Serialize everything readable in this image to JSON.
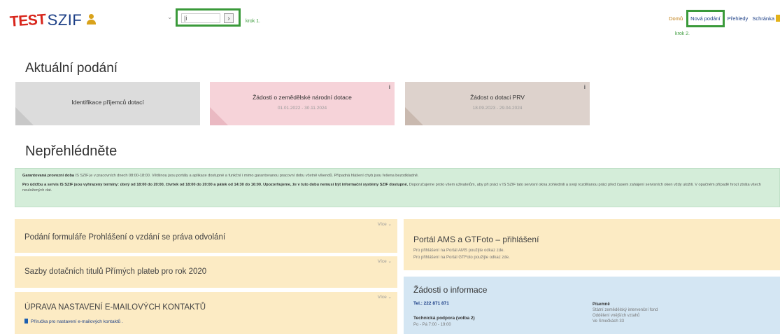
{
  "header": {
    "logo_test": "TEST",
    "logo_szif": "SZIF",
    "search_value": "|i",
    "search_button": "›",
    "krok1": "krok 1.",
    "nav": {
      "domu": "Domů",
      "nova_podani": "Nová podání",
      "prehledy": "Přehledy",
      "schranka": "Schránka"
    },
    "krok2": "krok 2."
  },
  "aktualni": {
    "heading": "Aktuální podání",
    "tiles": [
      {
        "title": "Identifikace příjemců dotací",
        "date": "",
        "info": ""
      },
      {
        "title": "Žádosti o zemědělské národní dotace",
        "date": "01.01.2022 - 30.11.2024",
        "info": "i"
      },
      {
        "title": "Žádost o dotaci PRV",
        "date": "18.09.2023 - 29.04.2024",
        "info": "i"
      }
    ]
  },
  "neprehlednete": {
    "heading": "Nepřehlédněte",
    "notice": {
      "p1_bold": "Garantovaná provozní doba",
      "p1_text": " IS SZIF je v pracovních dnech 08:00-18:00. Většinou jsou portály a aplikace dostupné a funkční i mimo garantovanou pracovní dobu včetně víkendů. Případná hlášení chyb jsou řešena bezodkladně.",
      "p2_bold": "Pro údržbu a servis IS SZIF jsou vyhrazeny termíny: úterý od 18:00 do 20:00, čtvrtek od 18:00 do 20:00 a pátek od 14:30 do 16:00. Upozorňujeme, že v tuto dobu nemusí být informační systémy SZIF dostupné.",
      "p2_text": " Doporučujeme proto všem uživatelům, aby při práci v IS SZIF tato servisní okna zohlednili a svoji rozdělanou práci před časem zahájení servisních oken vždy uložili. V opačném případě hrozí ztráta všech neuložených dat."
    },
    "vice": "Více ⌄",
    "cards": [
      {
        "title": "Podání formuláře Prohlášení o vzdání se práva odvolání"
      },
      {
        "title": "Sazby dotačních titulů Přímých plateb pro rok 2020"
      },
      {
        "title": "ÚPRAVA NASTAVENÍ E-MAILOVÝCH KONTAKTŮ",
        "link": "Příručka pro nastavení e-mailových kontaktů ."
      }
    ],
    "ams": {
      "title": "Portál AMS a GTFoto – přihlášení",
      "line1": "Pro přihlášení na Portál AMS použijte odkaz zde.",
      "line2": "Pro přihlášení na Portál GTFoto použijte odkaz zde."
    },
    "info": {
      "title": "Žádosti o informace",
      "tel": "Tel.: 222 871 871",
      "tech": "Technická podpora (volba 2)",
      "hours": "Po - Pá 7:00 - 19:00",
      "col2_head": "Písemně",
      "col2_l1": "Státní zemědělský intervenční fond",
      "col2_l2": "Oddělení vnějších vztahů",
      "col2_l3": "Ve Smečkách 33"
    }
  },
  "colors": {
    "brand_red": "#d8251b",
    "brand_blue": "#1c3f86",
    "annotation_green": "#3a9a3a",
    "notice_bg": "#d4edd9",
    "card_yellow": "#fcebc4",
    "card_blue": "#d4e6f3"
  }
}
